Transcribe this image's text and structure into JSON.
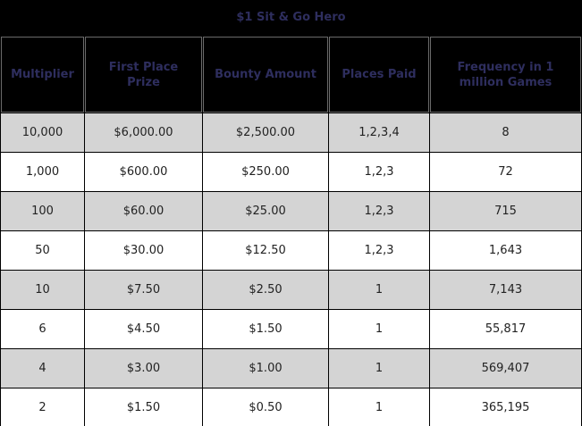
{
  "title": "$1 Sit & Go Hero",
  "columns": [
    "Multiplier",
    "First Place Prize",
    "Bounty Amount",
    "Places Paid",
    "Frequency in 1 million Games"
  ],
  "rows": [
    [
      "10,000",
      "$6,000.00",
      "$2,500.00",
      "1,2,3,4",
      "8"
    ],
    [
      "1,000",
      "$600.00",
      "$250.00",
      "1,2,3",
      "72"
    ],
    [
      "100",
      "$60.00",
      "$25.00",
      "1,2,3",
      "715"
    ],
    [
      "50",
      "$30.00",
      "$12.50",
      "1,2,3",
      "1,643"
    ],
    [
      "10",
      "$7.50",
      "$2.50",
      "1",
      "7,143"
    ],
    [
      "6",
      "$4.50",
      "$1.50",
      "1",
      "55,817"
    ],
    [
      "4",
      "$3.00",
      "$1.00",
      "1",
      "569,407"
    ],
    [
      "2",
      "$1.50",
      "$0.50",
      "1",
      "365,195"
    ]
  ],
  "colors": {
    "header_text": "#2e2e5e",
    "shaded_row": "#d4d4d4",
    "plain_row": "#ffffff",
    "background": "#000000"
  }
}
